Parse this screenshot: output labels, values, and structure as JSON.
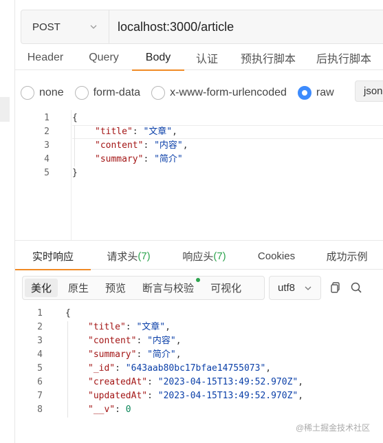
{
  "request": {
    "method": "POST",
    "url": "localhost:3000/article"
  },
  "req_tabs": [
    "Header",
    "Query",
    "Body",
    "认证",
    "预执行脚本",
    "后执行脚本"
  ],
  "body_types": [
    "none",
    "form-data",
    "x-www-form-urlencoded",
    "raw"
  ],
  "body_format": "json",
  "request_body": {
    "line_numbers": [
      "1",
      "2",
      "3",
      "4",
      "5"
    ],
    "open_brace": "{",
    "close_brace": "}",
    "fields": [
      {
        "key": "\"title\"",
        "value": "\"文章\"",
        "trail": ","
      },
      {
        "key": "\"content\"",
        "value": "\"内容\"",
        "trail": ","
      },
      {
        "key": "\"summary\"",
        "value": "\"简介\"",
        "trail": ""
      }
    ]
  },
  "resp_tabs": {
    "realtime": "实时响应",
    "req_headers": "请求头",
    "req_headers_count": "(7)",
    "resp_headers": "响应头",
    "resp_headers_count": "(7)",
    "cookies": "Cookies",
    "success_example": "成功示例"
  },
  "toolbar": {
    "beautify": "美化",
    "raw": "原生",
    "preview": "预览",
    "assert": "断言与校验",
    "visualize": "可视化",
    "encoding": "utf8"
  },
  "response_body": {
    "line_numbers": [
      "1",
      "2",
      "3",
      "4",
      "5",
      "6",
      "7",
      "8"
    ],
    "open_brace": "{",
    "fields": [
      {
        "key": "\"title\"",
        "value": "\"文章\"",
        "type": "string",
        "trail": ","
      },
      {
        "key": "\"content\"",
        "value": "\"内容\"",
        "type": "string",
        "trail": ","
      },
      {
        "key": "\"summary\"",
        "value": "\"简介\"",
        "type": "string",
        "trail": ","
      },
      {
        "key": "\"_id\"",
        "value": "\"643aab80bc17bfae14755073\"",
        "type": "string",
        "trail": ","
      },
      {
        "key": "\"createdAt\"",
        "value": "\"2023-04-15T13:49:52.970Z\"",
        "type": "string",
        "trail": ","
      },
      {
        "key": "\"updatedAt\"",
        "value": "\"2023-04-15T13:49:52.970Z\"",
        "type": "string",
        "trail": ","
      },
      {
        "key": "\"__v\"",
        "value": "0",
        "type": "number",
        "trail": ""
      }
    ]
  },
  "icons": {
    "method_dropdown": "chevron-down-icon",
    "encoding_dropdown": "chevron-down-icon",
    "copy": "copy-icon",
    "search": "search-icon"
  },
  "colors": {
    "accent": "#f08a24",
    "radio_selected": "#3d8bfd",
    "count": "#2da44e"
  },
  "watermark": "@稀土掘金技术社区"
}
